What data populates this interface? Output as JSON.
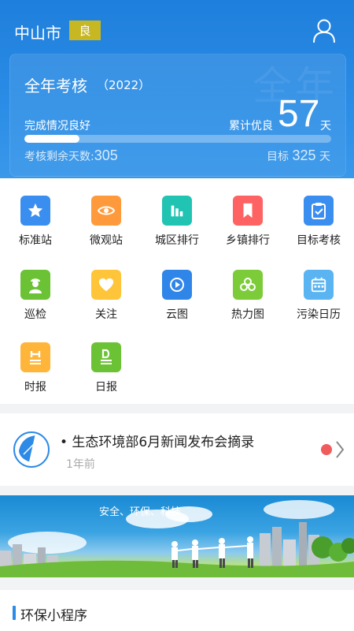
{
  "header": {
    "city": "中山市",
    "aqi_level": "良",
    "accent": "#c7b722"
  },
  "assessment": {
    "title": "全年考核",
    "year": "（2022）",
    "status": "完成情况良好",
    "accumulated_label": "累计优良",
    "accumulated_value": "57",
    "accumulated_unit": "天",
    "remaining_label": "考核剩余天数:",
    "remaining_value": "305",
    "target_label": "目标",
    "target_value": "325",
    "target_unit": "天",
    "progress_fraction": 0.18,
    "watermark": "全年"
  },
  "grid": [
    {
      "label": "标准站",
      "icon": "star-icon",
      "color": "#3a8ef0"
    },
    {
      "label": "微观站",
      "icon": "eye-icon",
      "color": "#ff9a3c"
    },
    {
      "label": "城区排行",
      "icon": "bar-chart-icon",
      "color": "#21c3b3"
    },
    {
      "label": "乡镇排行",
      "icon": "bookmark-icon",
      "color": "#ff6262"
    },
    {
      "label": "目标考核",
      "icon": "clipboard-check-icon",
      "color": "#3a8ef0"
    },
    {
      "label": "巡检",
      "icon": "inspector-icon",
      "color": "#6cc235"
    },
    {
      "label": "关注",
      "icon": "heart-icon",
      "color": "#ffc53a"
    },
    {
      "label": "云图",
      "icon": "cloud-map-icon",
      "color": "#2f86e8"
    },
    {
      "label": "热力图",
      "icon": "heatmap-icon",
      "color": "#7ccc3a"
    },
    {
      "label": "污染日历",
      "icon": "calendar-icon",
      "color": "#5bb4f2"
    },
    {
      "label": "时报",
      "icon": "hourly-report-icon",
      "color": "#ffb53a"
    },
    {
      "label": "日报",
      "icon": "daily-report-icon",
      "color": "#6cc235"
    }
  ],
  "news": {
    "title": "• 生态环境部6月新闻发布会摘录",
    "time": "1年前"
  },
  "banner": {
    "slogan": "安全、环保、科技"
  },
  "mini_programs": {
    "title": "环保小程序"
  }
}
